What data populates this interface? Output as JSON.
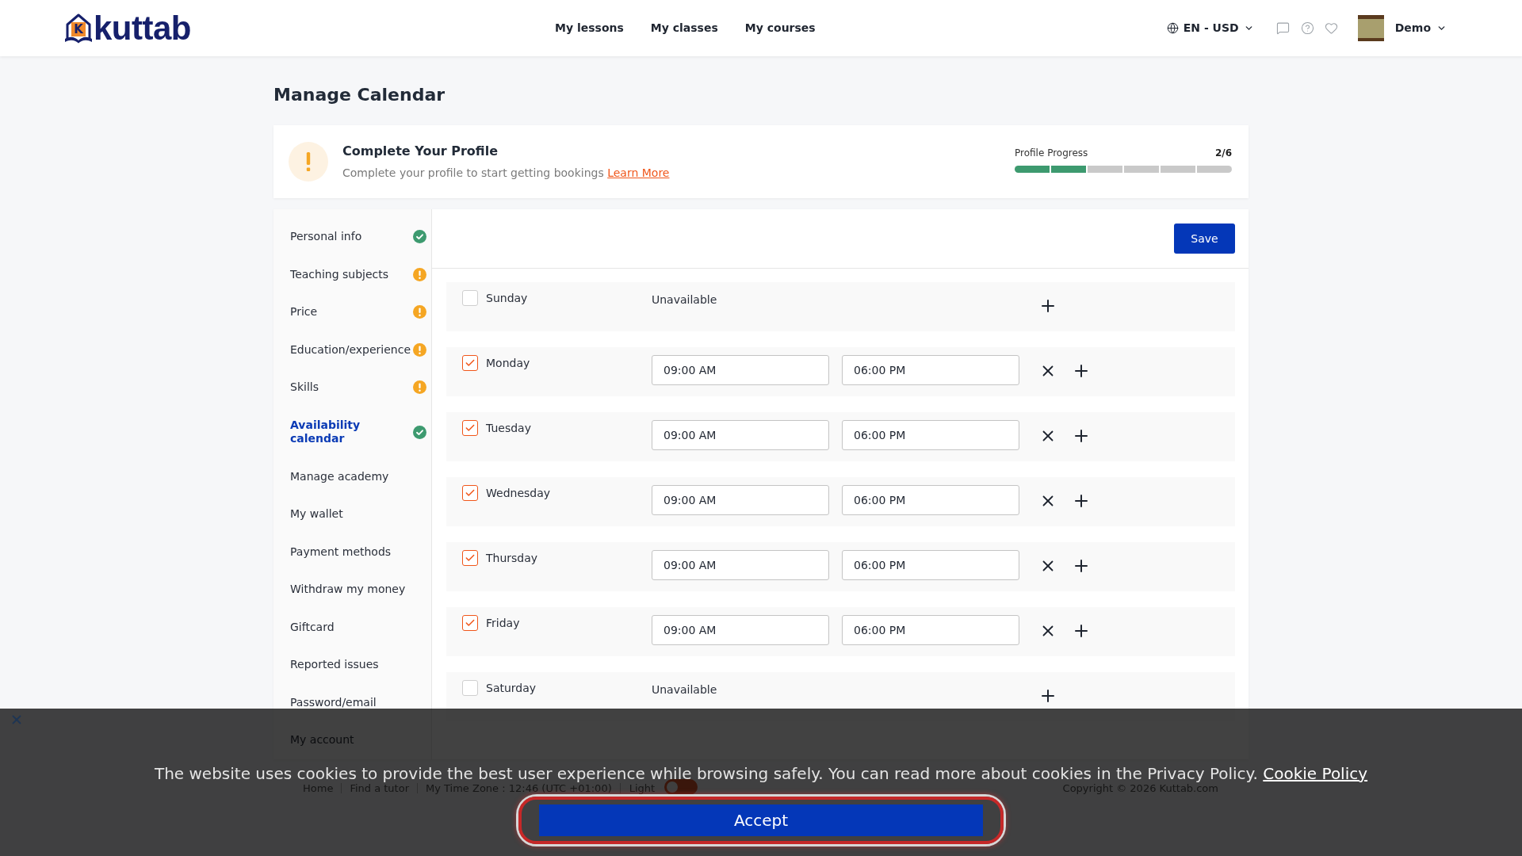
{
  "header": {
    "logo": {
      "letter": "K",
      "wordmark": "kuttab"
    },
    "nav": [
      "My lessons",
      "My classes",
      "My courses"
    ],
    "locale": "EN - USD",
    "user": {
      "name": "Demo"
    }
  },
  "page_title": "Manage Calendar",
  "profile_card": {
    "title": "Complete Your Profile",
    "text": "Complete your profile to start getting bookings",
    "link": "Learn More",
    "progress": {
      "label": "Profile Progress",
      "count": "2/6",
      "segments": [
        {
          "done": true
        },
        {
          "done": true
        },
        {
          "done": false
        },
        {
          "done": false
        },
        {
          "done": false
        },
        {
          "done": false
        }
      ]
    }
  },
  "sidebar": {
    "items": [
      {
        "label": "Personal info",
        "selected": false,
        "complete": true
      },
      {
        "label": "Teaching subjects",
        "selected": false,
        "complete": false
      },
      {
        "label": "Price",
        "selected": false,
        "complete": false
      },
      {
        "label": "Education/experience",
        "selected": false,
        "complete": false
      },
      {
        "label": "Skills",
        "selected": false,
        "complete": false
      },
      {
        "label": "Availability calendar",
        "selected": true,
        "complete": true
      },
      {
        "label": "Manage academy",
        "selected": false
      },
      {
        "label": "My wallet",
        "selected": false
      },
      {
        "label": "Payment methods",
        "selected": false
      },
      {
        "label": "Withdraw my money",
        "selected": false
      },
      {
        "label": "Giftcard",
        "selected": false
      },
      {
        "label": "Reported issues",
        "selected": false
      },
      {
        "label": "Password/email",
        "selected": false
      },
      {
        "label": "My account",
        "selected": false
      }
    ]
  },
  "calendar": {
    "save_button": "Save",
    "days": [
      {
        "day": "Sunday",
        "checked": false,
        "note": "Unavailable"
      },
      {
        "day": "Monday",
        "checked": true,
        "from": "09:00 AM",
        "to": "06:00 PM"
      },
      {
        "day": "Tuesday",
        "checked": true,
        "from": "09:00 AM",
        "to": "06:00 PM"
      },
      {
        "day": "Wednesday",
        "checked": true,
        "from": "09:00 AM",
        "to": "06:00 PM"
      },
      {
        "day": "Thursday",
        "checked": true,
        "from": "09:00 AM",
        "to": "06:00 PM"
      },
      {
        "day": "Friday",
        "checked": true,
        "from": "09:00 AM",
        "to": "06:00 PM"
      },
      {
        "day": "Saturday",
        "checked": false,
        "note": "Unavailable"
      }
    ]
  },
  "footer": {
    "links": [
      "Home",
      "Find a tutor"
    ],
    "timezone": "My Time Zone : 12:46 (UTC +01:00)",
    "theme": "Light",
    "theme_switch": {
      "on": false
    },
    "copyright": "Copyright © 2026 Kuttab.com"
  },
  "cookie_banner": {
    "text": "The website uses cookies to provide the best user experience while browsing safely. You can read more about cookies in the Privacy Policy.",
    "link": "Cookie Policy",
    "button": "Accept"
  }
}
